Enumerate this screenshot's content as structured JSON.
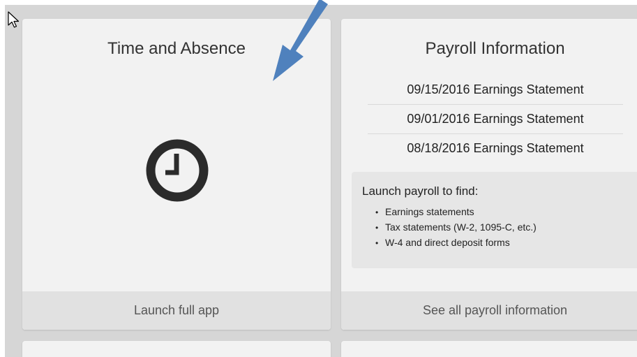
{
  "tiles": {
    "time_absence": {
      "title": "Time and Absence",
      "icon": "clock-icon",
      "footer_label": "Launch full app"
    },
    "payroll": {
      "title": "Payroll Information",
      "statements": [
        "09/15/2016 Earnings Statement",
        "09/01/2016 Earnings Statement",
        "08/18/2016 Earnings Statement"
      ],
      "launch_intro": "Launch payroll to find:",
      "launch_items": [
        "Earnings statements",
        "Tax statements (W-2, 1095-C, etc.)",
        "W-4 and direct deposit forms"
      ],
      "footer_label": "See all payroll information"
    }
  },
  "colors": {
    "page_background": "#d6d6d6",
    "tile_background": "#f2f2f2",
    "tile_footer": "#e1e1e1",
    "annotation_arrow": "#4f81bd",
    "clock_icon": "#2b2b2b"
  }
}
